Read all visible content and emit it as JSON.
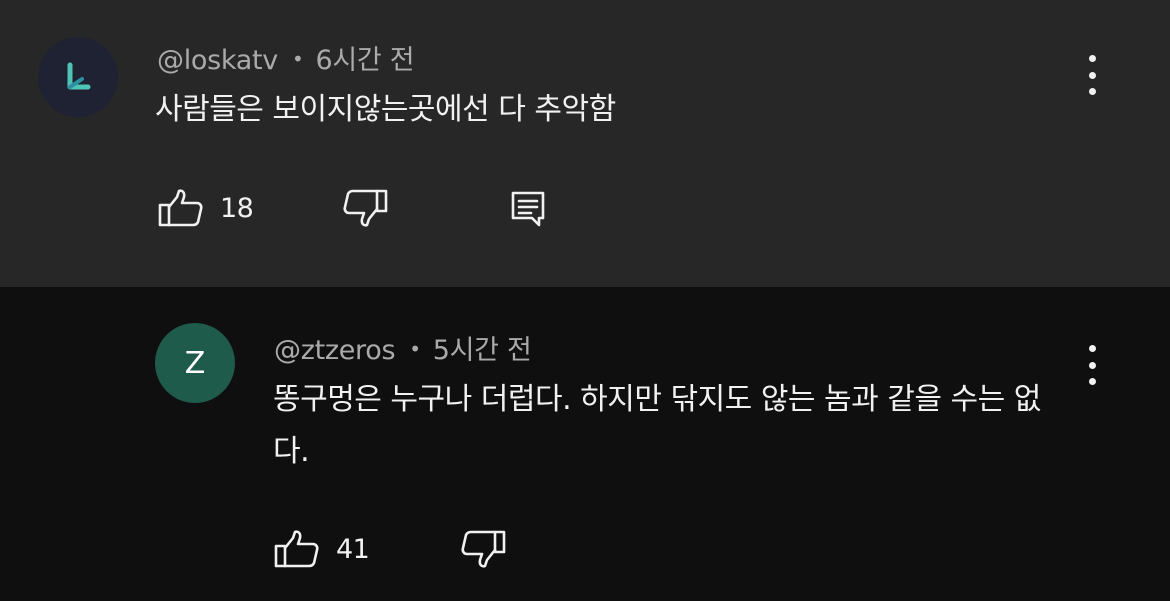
{
  "comments": [
    {
      "avatar_icon": "stylized-L-logo-icon",
      "avatar_color": "#1e2233",
      "accent_color": "#4fc3b5",
      "username": "@loskatv",
      "separator": "•",
      "time": "6시간 전",
      "text": "사람들은 보이지않는곳에선 다 추악함",
      "likes": "18",
      "actions": [
        "like",
        "dislike",
        "reply"
      ]
    },
    {
      "avatar_letter": "Z",
      "avatar_color": "#1f5b4a",
      "username": "@ztzeros",
      "separator": "•",
      "time": "5시간 전",
      "text": "똥구멍은 누구나 더럽다. 하지만 닦지도 않는 놈과 같을 수는 없다.",
      "likes": "41",
      "actions": [
        "like",
        "dislike"
      ]
    }
  ]
}
